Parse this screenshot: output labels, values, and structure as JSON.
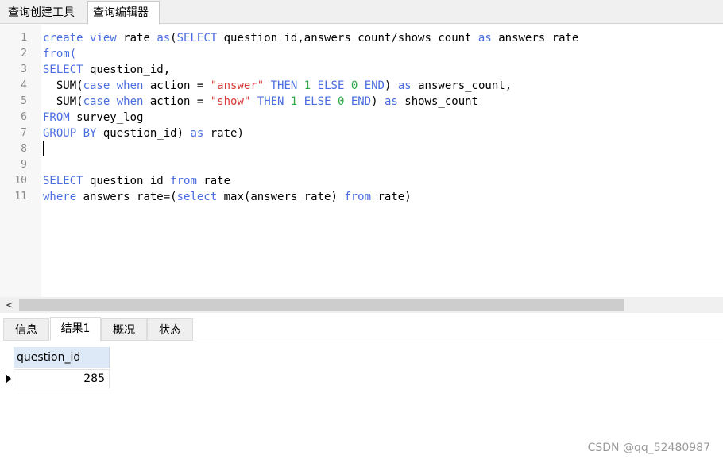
{
  "top_tabs": {
    "query_builder": "查询创建工具",
    "query_editor": "查询编辑器"
  },
  "editor": {
    "lines": [
      {
        "n": "1",
        "tokens": [
          {
            "t": "create",
            "c": "kw"
          },
          {
            "t": " "
          },
          {
            "t": "view",
            "c": "kw"
          },
          {
            "t": " rate "
          },
          {
            "t": "as",
            "c": "kw"
          },
          {
            "t": "("
          },
          {
            "t": "SELECT",
            "c": "kw"
          },
          {
            "t": " question_id,answers_count/shows_count "
          },
          {
            "t": "as",
            "c": "kw"
          },
          {
            "t": " answers_rate"
          }
        ]
      },
      {
        "n": "2",
        "tokens": [
          {
            "t": "from(",
            "c": "kw"
          }
        ]
      },
      {
        "n": "3",
        "tokens": [
          {
            "t": "SELECT",
            "c": "kw"
          },
          {
            "t": " question_id,"
          }
        ]
      },
      {
        "n": "4",
        "tokens": [
          {
            "t": "  SUM("
          },
          {
            "t": "case",
            "c": "kw"
          },
          {
            "t": " "
          },
          {
            "t": "when",
            "c": "kw"
          },
          {
            "t": " action = "
          },
          {
            "t": "\"answer\"",
            "c": "str"
          },
          {
            "t": " "
          },
          {
            "t": "THEN",
            "c": "kw"
          },
          {
            "t": " "
          },
          {
            "t": "1",
            "c": "num"
          },
          {
            "t": " "
          },
          {
            "t": "ELSE",
            "c": "kw"
          },
          {
            "t": " "
          },
          {
            "t": "0",
            "c": "num"
          },
          {
            "t": " "
          },
          {
            "t": "END",
            "c": "kw"
          },
          {
            "t": ") "
          },
          {
            "t": "as",
            "c": "kw"
          },
          {
            "t": " answers_count,"
          }
        ]
      },
      {
        "n": "5",
        "tokens": [
          {
            "t": "  SUM("
          },
          {
            "t": "case",
            "c": "kw"
          },
          {
            "t": " "
          },
          {
            "t": "when",
            "c": "kw"
          },
          {
            "t": " action = "
          },
          {
            "t": "\"show\"",
            "c": "str"
          },
          {
            "t": " "
          },
          {
            "t": "THEN",
            "c": "kw"
          },
          {
            "t": " "
          },
          {
            "t": "1",
            "c": "num"
          },
          {
            "t": " "
          },
          {
            "t": "ELSE",
            "c": "kw"
          },
          {
            "t": " "
          },
          {
            "t": "0",
            "c": "num"
          },
          {
            "t": " "
          },
          {
            "t": "END",
            "c": "kw"
          },
          {
            "t": ") "
          },
          {
            "t": "as",
            "c": "kw"
          },
          {
            "t": " shows_count"
          }
        ]
      },
      {
        "n": "6",
        "tokens": [
          {
            "t": "FROM",
            "c": "kw"
          },
          {
            "t": " survey_log"
          }
        ]
      },
      {
        "n": "7",
        "tokens": [
          {
            "t": "GROUP BY",
            "c": "kw"
          },
          {
            "t": " question_id) "
          },
          {
            "t": "as",
            "c": "kw"
          },
          {
            "t": " rate)"
          }
        ]
      },
      {
        "n": "8",
        "tokens": []
      },
      {
        "n": "9",
        "tokens": []
      },
      {
        "n": "10",
        "tokens": [
          {
            "t": "SELECT",
            "c": "kw"
          },
          {
            "t": " question_id "
          },
          {
            "t": "from",
            "c": "kw"
          },
          {
            "t": " rate"
          }
        ]
      },
      {
        "n": "11",
        "tokens": [
          {
            "t": "where",
            "c": "kw"
          },
          {
            "t": " answers_rate=("
          },
          {
            "t": "select",
            "c": "kw"
          },
          {
            "t": " max(answers_rate) "
          },
          {
            "t": "from",
            "c": "kw"
          },
          {
            "t": " rate)"
          }
        ]
      }
    ]
  },
  "scrollbar": {
    "left_arrow": "<"
  },
  "bottom_tabs": {
    "info": "信息",
    "result1": "结果1",
    "profile": "概况",
    "status": "状态"
  },
  "result_grid": {
    "columns": [
      "question_id"
    ],
    "rows": [
      [
        "285"
      ]
    ]
  },
  "watermark": "CSDN @qq_52480987",
  "colors": {
    "keyword": "#4a6de0",
    "string": "#d83a3a",
    "number": "#2fa84a",
    "grid_header": "#dde9f7"
  }
}
